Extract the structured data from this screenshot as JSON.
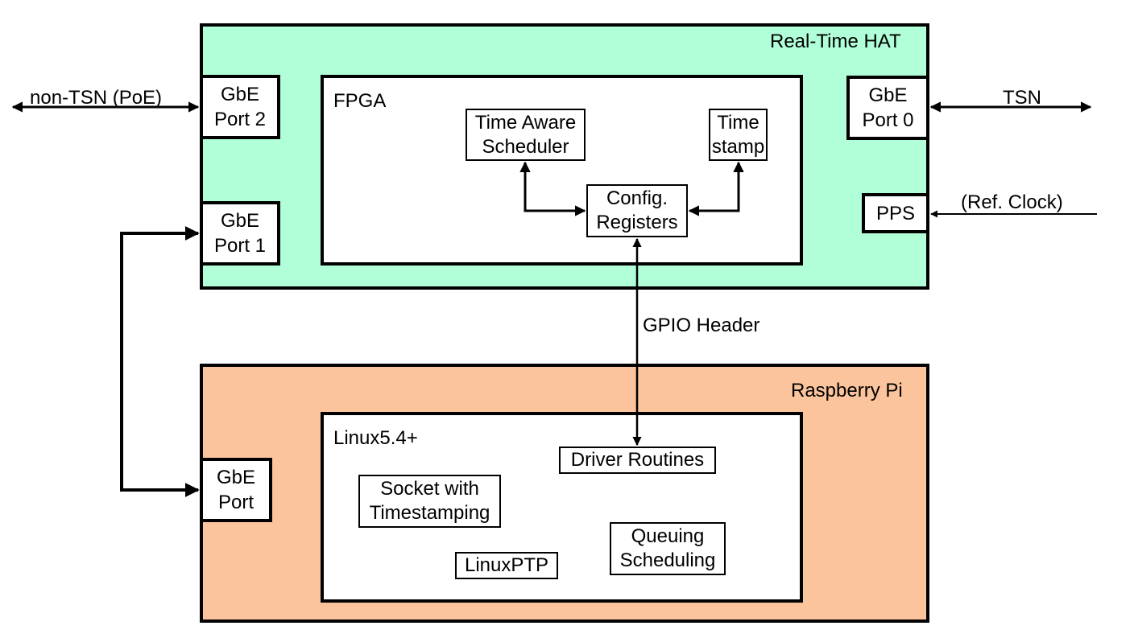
{
  "diagram": {
    "hat": {
      "title": "Real-Time HAT",
      "color": "#b0ffd8",
      "fpga": {
        "title": "FPGA",
        "blocks": {
          "tas": "Time Aware\nScheduler",
          "timestamp": "Time\nstamp",
          "config": "Config.\nRegisters"
        }
      },
      "ports": {
        "port2": "GbE\nPort 2",
        "port1": "GbE\nPort 1",
        "port0": "GbE\nPort 0",
        "pps": "PPS"
      }
    },
    "rpi": {
      "title": "Raspberry Pi",
      "color": "#fbc49c",
      "port": "GbE\nPort",
      "linux": {
        "title": "Linux5.4+",
        "blocks": {
          "driver": "Driver Routines",
          "socket": "Socket with\nTimestamping",
          "linuxptp": "LinuxPTP",
          "queuing": "Queuing\nScheduling"
        }
      }
    },
    "links": {
      "non_tsn": "non-TSN (PoE)",
      "tsn": "TSN",
      "ref_clock": "(Ref. Clock)",
      "gpio": "GPIO Header"
    }
  }
}
